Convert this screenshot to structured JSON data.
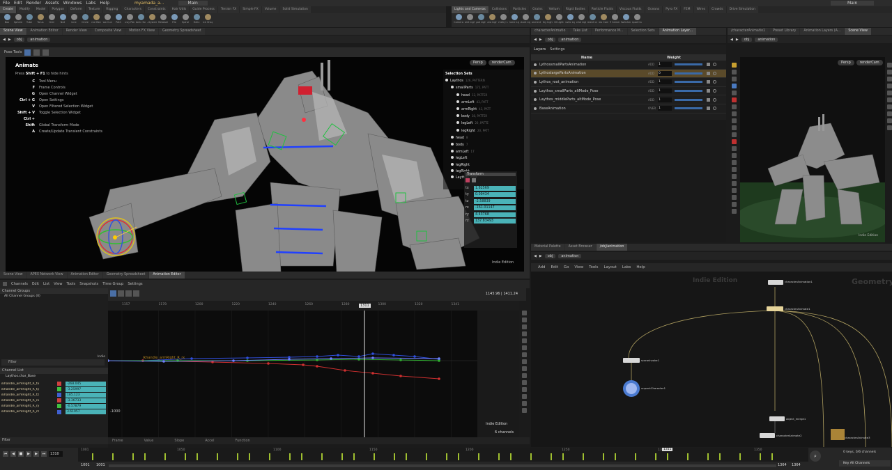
{
  "menubar": {
    "items": [
      "File",
      "Edit",
      "Render",
      "Assets",
      "Windows",
      "Labs",
      "Help"
    ],
    "file_name": "myamada_a...",
    "desktop": "Main",
    "desktop_right": "Main"
  },
  "shelf_tabs_left": [
    "Create",
    "Modify",
    "Model",
    "Polygon",
    "Deform",
    "Texture",
    "Rigging",
    "Characters",
    "Constraints",
    "Hair Utils",
    "Guide Process",
    "Terrain FX",
    "Simple FX",
    "Volume",
    "Solid Simulation"
  ],
  "shelf_tabs_right": [
    "Lights and Cameras",
    "Collisions",
    "Particles",
    "Grains",
    "Vellum",
    "Rigid Bodies",
    "Particle Fluids",
    "Viscous Fluids",
    "Oceans",
    "Pyro FX",
    "FEM",
    "Wires",
    "Crowds",
    "Drive Simulation"
  ],
  "tools_left": [
    "Box",
    "Sphere",
    "Tube",
    "Torus",
    "Grid",
    "Null",
    "Line",
    "Circle",
    "Curve Bezier",
    "Draw Curve",
    "Path",
    "Spray Paint",
    "Platonic Solids",
    "L-System",
    "Metaball",
    "File",
    "Spiral",
    "Helix",
    "Quick Shapes"
  ],
  "tools_right": [
    "Camera",
    "Point Light",
    "Spot Light",
    "Area Light",
    "Geometry Light",
    "Volume Light",
    "Distant Light",
    "Environment Light",
    "Sky Light",
    "GI Light",
    "Caustic Light",
    "Portal Light",
    "Ambient Light",
    "Stereo Camera",
    "VR Camera",
    "Switcher",
    "Gamepad Camera"
  ],
  "viewport_tabs": [
    "Scene View",
    "Animation Editor",
    "Render View",
    "Composite View",
    "Motion FX View",
    "Geometry Spreadsheet"
  ],
  "path": {
    "obj": "obj",
    "context": "animation"
  },
  "pose_tools_label": "Pose Tools",
  "hints": {
    "title": "Animate",
    "intro_pre": "Press",
    "intro_key": "Shift + F1",
    "intro_post": "to hide hints",
    "items": [
      {
        "key": "C",
        "text": "Tool Menu"
      },
      {
        "key": "F",
        "text": "Frame Controls"
      },
      {
        "key": "G",
        "text": "Open Channel Widget"
      },
      {
        "key": "Ctrl + G",
        "text": "Open Settings"
      },
      {
        "key": "V",
        "text": "Open Filtered Selection Widget"
      },
      {
        "key": "Shift + V",
        "text": "Toggle Selection Widget"
      },
      {
        "key": "Ctrl + Shift",
        "text": "Global Transform Mode"
      },
      {
        "key": "A",
        "text": "Create/Update Transient Constraints"
      }
    ]
  },
  "persp_label": "Persp",
  "rendercam_label": "renderCam",
  "indie_label": "Indie Edition",
  "selection_sets": {
    "title": "Selection Sets",
    "items": [
      {
        "name": "Laythos",
        "tag": "126, PATTERN",
        "indent": 0
      },
      {
        "name": "smallParts",
        "tag": "172, PATT",
        "indent": 1
      },
      {
        "name": "head",
        "tag": "12, PATTER",
        "indent": 2
      },
      {
        "name": "armLeft",
        "tag": "43, PATT",
        "indent": 2
      },
      {
        "name": "armRight",
        "tag": "43, PATT",
        "indent": 2
      },
      {
        "name": "body",
        "tag": "38, PATTER",
        "indent": 2
      },
      {
        "name": "legLeft",
        "tag": "20, PATTE",
        "indent": 2
      },
      {
        "name": "legRight",
        "tag": "20, PATT",
        "indent": 2
      },
      {
        "name": "head",
        "tag": "8",
        "indent": 1
      },
      {
        "name": "body",
        "tag": "7",
        "indent": 1
      },
      {
        "name": "armLeft",
        "tag": "17",
        "indent": 1
      },
      {
        "name": "legLeft",
        "tag": "",
        "indent": 1
      },
      {
        "name": "legRight",
        "tag": "",
        "indent": 1
      },
      {
        "name": "legRight",
        "tag": "",
        "indent": 1
      },
      {
        "name": "Laythos_root",
        "tag": "",
        "indent": 1
      }
    ]
  },
  "transform": {
    "title": "Transform",
    "rows": [
      {
        "axis": "tx",
        "value": "1.82569"
      },
      {
        "axis": "ty",
        "value": "0.09434"
      },
      {
        "axis": "tz",
        "value": "-2.58839"
      },
      {
        "axis": "rx",
        "value": "-161.01147"
      },
      {
        "axis": "ry",
        "value": "4.43768"
      },
      {
        "axis": "rz",
        "value": "137.83493"
      }
    ]
  },
  "animlayers_tabs": [
    "characterAnimatio",
    "Take List",
    "Performance M...",
    "Selection Sets",
    "Animation Layer..."
  ],
  "animlayers": {
    "header": {
      "tab1": "Layers",
      "tab2": "Settings",
      "name_col": "Name",
      "weight_col": "Weight"
    },
    "rows": [
      {
        "name": "LythossmallPartsAnimation",
        "mode": "ADD",
        "weight": "1",
        "selected": false
      },
      {
        "name": "LythoslargePartsAnimation",
        "mode": "ADD",
        "weight": "0",
        "selected": true
      },
      {
        "name": "Lythos_root_animation",
        "mode": "ADD",
        "weight": "1",
        "selected": false
      },
      {
        "name": "Laythos_smallParts_altMode_Pose",
        "mode": "ADD",
        "weight": "1",
        "selected": false
      },
      {
        "name": "Laythos_middleParts_altMode_Pose",
        "mode": "ADD",
        "weight": "1",
        "selected": false
      },
      {
        "name": "BaseAnimation",
        "mode": "OVER",
        "weight": "1",
        "selected": false
      }
    ]
  },
  "right_tabs": [
    "/characterAnimatio1",
    "Preset Library",
    "Animation Layers (A...",
    "Scene View"
  ],
  "bottom_tabs": [
    "Scene View",
    "APEX Network View",
    "Animation Editor",
    "Geometry Spreadsheet",
    "Animation Editor"
  ],
  "anim_menus": [
    "Edit",
    "List",
    "View",
    "Tools",
    "Snapshots",
    "Time Group",
    "Settings"
  ],
  "channel_groups": {
    "title": "Channel Groups",
    "item": "All Channel Groups (0)",
    "indie": "Indie",
    "filter": "Filter"
  },
  "channel_list": {
    "title": "Channel List",
    "root": "Laythos.char_Base",
    "rows": [
      {
        "name": "ikhandle_armRight_R_tx",
        "value": "-268.045",
        "color": "#d04040"
      },
      {
        "name": "ikhandle_armRight_R_ty",
        "value": "-3.25997",
        "color": "#40c040"
      },
      {
        "name": "ikhandle_armRight_R_tz",
        "value": "185.123",
        "color": "#4060d0"
      },
      {
        "name": "ikhandle_armRight_R_rx",
        "value": "-3.36733",
        "color": "#d04040"
      },
      {
        "name": "ikhandle_armRight_R_ry",
        "value": "-0.57879",
        "color": "#40c040"
      },
      {
        "name": "ikhandle_armRight_R_rz",
        "value": "3.61957",
        "color": "#4060d0"
      }
    ]
  },
  "graph": {
    "ticks": [
      "1157",
      "1178",
      "1200",
      "1220",
      "1240",
      "1260",
      "1280",
      "1300",
      "1320",
      "1341"
    ],
    "current_frame": "1311",
    "range_readout": "1145.96 | 1411.24",
    "y_label": "-1000",
    "channel_text": "ikhandle_armRight_R_rx",
    "indie": "Indie Edition",
    "channels_count": "6 channels"
  },
  "graph_bottom": {
    "labels": [
      "Frame",
      "Value",
      "Slope",
      "Accel",
      "Function"
    ]
  },
  "network_tabs": [
    "Material Palette",
    "Asset Browser",
    "/obj/animation"
  ],
  "network_menus": [
    "Add",
    "Edit",
    "Go",
    "View",
    "Tools",
    "Layout",
    "Labs",
    "Help"
  ],
  "network": {
    "watermark_left": "Indie Edition",
    "watermark_right": "Geometry",
    "nodes": [
      {
        "label": "characterAnimation1"
      },
      {
        "label": "characterAnimate1"
      },
      {
        "label": "sceneInvoke1"
      },
      {
        "label": "unpackCharacter1"
      },
      {
        "label": "object_merge1"
      },
      {
        "label": "characterAnimate2"
      },
      {
        "label": "characterAnimate3"
      }
    ]
  },
  "timeline": {
    "frame": "1310",
    "start": "1001",
    "start2": "1001",
    "end": "1364",
    "end2": "1364",
    "ticks": [
      "1001",
      "1050",
      "1100",
      "1150",
      "1200",
      "1250",
      "1300",
      "1350"
    ],
    "marker": "1311",
    "keys_label": "0 keys, 0/6 channels",
    "key_all_label": "Key All Channels"
  }
}
